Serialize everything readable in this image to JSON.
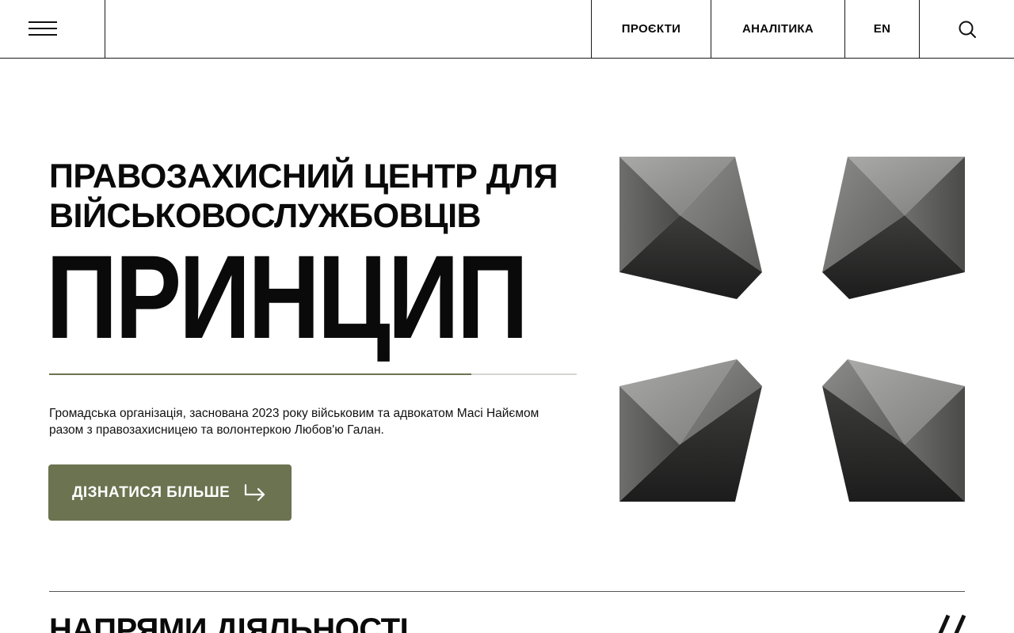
{
  "header": {
    "menu_icon": "hamburger-menu-icon",
    "nav": {
      "projects": "ПРОЄКТИ",
      "analytics": "АНАЛІТИКА",
      "language": "EN"
    },
    "search_icon": "search-icon"
  },
  "hero": {
    "subtitle": "ПРАВОЗАХИСНИЙ ЦЕНТР ДЛЯ ВІЙСЬКОВОСЛУЖБОВЦІВ",
    "title": "ПРИНЦИП",
    "description": "Громадська організація, заснована 2023 року військовим та адвокатом Масі Найємом разом з правозахисницею та волонтеркою Любов'ю Галан.",
    "cta_label": "ДІЗНАТИСЯ БІЛЬШЕ",
    "cta_icon": "arrow-right-icon",
    "progress_fraction": 0.8
  },
  "section": {
    "title": "НАПРЯМИ ДІЯЛЬНОСТІ"
  },
  "colors": {
    "accent": "#6b7350",
    "text": "#0a0a0a",
    "background": "#ffffff"
  }
}
